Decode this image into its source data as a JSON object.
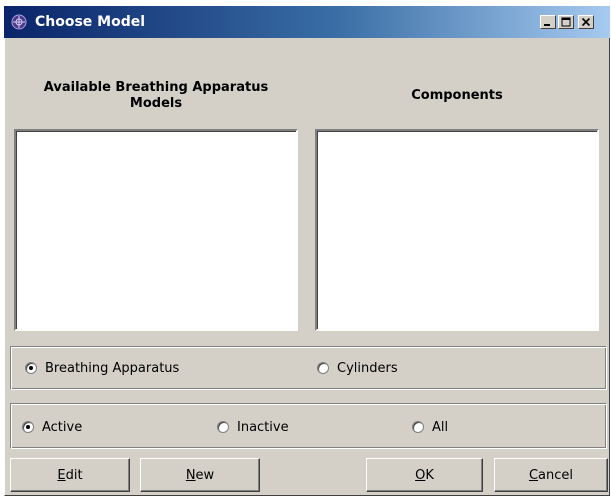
{
  "window": {
    "title": "Choose Model"
  },
  "columns": {
    "models_heading_line1": "Available Breathing Apparatus",
    "models_heading_line2": "Models",
    "components_heading": "Components"
  },
  "type_group": {
    "options": [
      {
        "label": "Breathing Apparatus",
        "checked": true
      },
      {
        "label": "Cylinders",
        "checked": false
      }
    ]
  },
  "status_group": {
    "options": [
      {
        "label": "Active",
        "checked": true
      },
      {
        "label": "Inactive",
        "checked": false
      },
      {
        "label": "All",
        "checked": false
      }
    ]
  },
  "buttons": {
    "edit": {
      "mnemonic": "E",
      "rest": "dit"
    },
    "new": {
      "mnemonic": "N",
      "rest": "ew"
    },
    "ok": {
      "mnemonic": "O",
      "rest": "K"
    },
    "cancel": {
      "mnemonic": "C",
      "rest": "ancel"
    }
  },
  "icons": {
    "app": "app-logo-icon",
    "minimize": "minimize-icon",
    "maximize": "maximize-icon",
    "close": "close-icon"
  }
}
